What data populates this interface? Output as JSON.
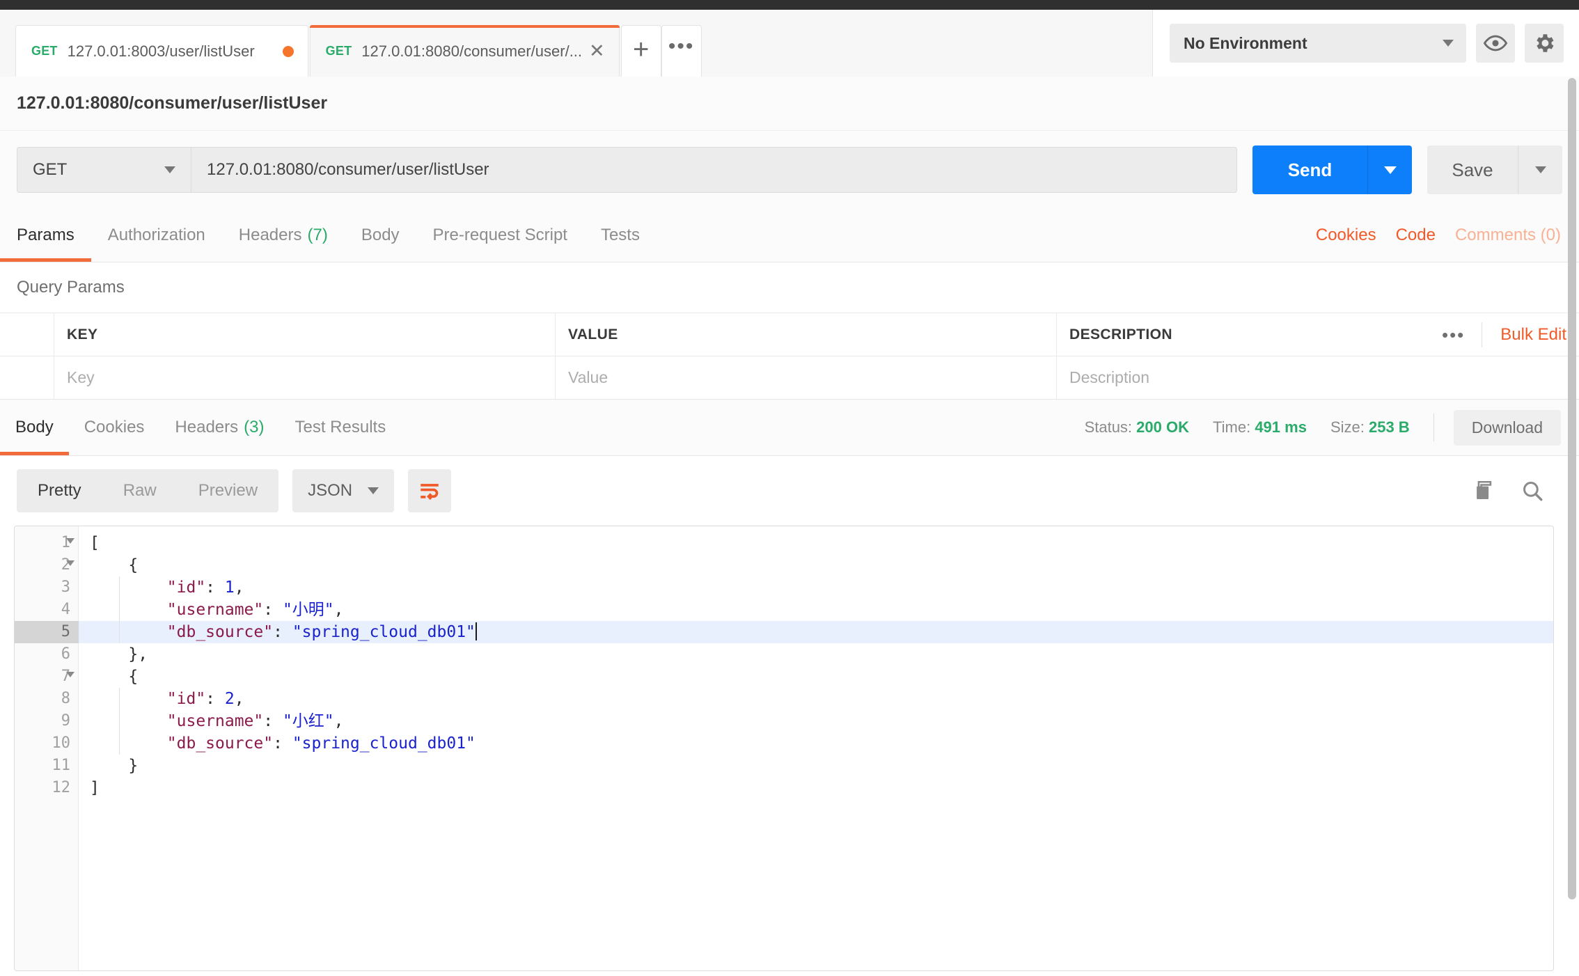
{
  "window": {
    "tabs": [
      {
        "method": "GET",
        "label": "127.0.01:8003/user/listUser",
        "active": false,
        "unsaved": true
      },
      {
        "method": "GET",
        "label": "127.0.01:8080/consumer/user/...",
        "active": true,
        "unsaved": false
      }
    ],
    "new_tab_label": "+",
    "more_tabs_label": "•••"
  },
  "environment": {
    "selected": "No Environment",
    "eye_icon": "eye-icon",
    "settings_icon": "gear-icon"
  },
  "request": {
    "title": "127.0.01:8080/consumer/user/listUser",
    "method": "GET",
    "url": "127.0.01:8080/consumer/user/listUser",
    "send_label": "Send",
    "save_label": "Save",
    "tabs": [
      {
        "label": "Params",
        "count": "",
        "active": true
      },
      {
        "label": "Authorization",
        "count": "",
        "active": false
      },
      {
        "label": "Headers",
        "count": "(7)",
        "active": false
      },
      {
        "label": "Body",
        "count": "",
        "active": false
      },
      {
        "label": "Pre-request Script",
        "count": "",
        "active": false
      },
      {
        "label": "Tests",
        "count": "",
        "active": false
      }
    ],
    "right_links": [
      {
        "label": "Cookies",
        "muted": false
      },
      {
        "label": "Code",
        "muted": false
      },
      {
        "label": "Comments (0)",
        "muted": true
      }
    ]
  },
  "query_params": {
    "section_title": "Query Params",
    "headers": {
      "key": "KEY",
      "value": "VALUE",
      "description": "DESCRIPTION"
    },
    "placeholders": {
      "key": "Key",
      "value": "Value",
      "description": "Description"
    },
    "dots_label": "•••",
    "bulk_edit_label": "Bulk Edit"
  },
  "response": {
    "tabs": [
      {
        "label": "Body",
        "count": "",
        "active": true
      },
      {
        "label": "Cookies",
        "count": "",
        "active": false
      },
      {
        "label": "Headers",
        "count": "(3)",
        "active": false
      },
      {
        "label": "Test Results",
        "count": "",
        "active": false
      }
    ],
    "status_label": "Status:",
    "status_value": "200 OK",
    "time_label": "Time:",
    "time_value": "491 ms",
    "size_label": "Size:",
    "size_value": "253 B",
    "download_label": "Download",
    "view_modes": [
      {
        "label": "Pretty",
        "active": true
      },
      {
        "label": "Raw",
        "active": false
      },
      {
        "label": "Preview",
        "active": false
      }
    ],
    "format": "JSON",
    "wrap_icon": "word-wrap-icon",
    "copy_icon": "copy-icon",
    "search_icon": "search-icon",
    "body_lines": [
      {
        "n": "1",
        "fold": true,
        "indent": 0,
        "tokens": [
          {
            "t": "punct",
            "v": "["
          }
        ]
      },
      {
        "n": "2",
        "fold": true,
        "indent": 0,
        "tokens": [
          {
            "t": "punct",
            "v": "    {"
          }
        ]
      },
      {
        "n": "3",
        "fold": false,
        "indent": 1,
        "tokens": [
          {
            "t": "key",
            "v": "        \"id\""
          },
          {
            "t": "punct",
            "v": ": "
          },
          {
            "t": "num",
            "v": "1"
          },
          {
            "t": "punct",
            "v": ","
          }
        ]
      },
      {
        "n": "4",
        "fold": false,
        "indent": 1,
        "tokens": [
          {
            "t": "key",
            "v": "        \"username\""
          },
          {
            "t": "punct",
            "v": ": "
          },
          {
            "t": "str",
            "v": "\"小明\""
          },
          {
            "t": "punct",
            "v": ","
          }
        ]
      },
      {
        "n": "5",
        "fold": false,
        "indent": 1,
        "active": true,
        "cursor": true,
        "tokens": [
          {
            "t": "key",
            "v": "        \"db_source\""
          },
          {
            "t": "punct",
            "v": ": "
          },
          {
            "t": "str",
            "v": "\"spring_cloud_db01\""
          }
        ]
      },
      {
        "n": "6",
        "fold": false,
        "indent": 0,
        "tokens": [
          {
            "t": "punct",
            "v": "    },"
          }
        ]
      },
      {
        "n": "7",
        "fold": true,
        "indent": 0,
        "tokens": [
          {
            "t": "punct",
            "v": "    {"
          }
        ]
      },
      {
        "n": "8",
        "fold": false,
        "indent": 1,
        "tokens": [
          {
            "t": "key",
            "v": "        \"id\""
          },
          {
            "t": "punct",
            "v": ": "
          },
          {
            "t": "num",
            "v": "2"
          },
          {
            "t": "punct",
            "v": ","
          }
        ]
      },
      {
        "n": "9",
        "fold": false,
        "indent": 1,
        "tokens": [
          {
            "t": "key",
            "v": "        \"username\""
          },
          {
            "t": "punct",
            "v": ": "
          },
          {
            "t": "str",
            "v": "\"小红\""
          },
          {
            "t": "punct",
            "v": ","
          }
        ]
      },
      {
        "n": "10",
        "fold": false,
        "indent": 1,
        "tokens": [
          {
            "t": "key",
            "v": "        \"db_source\""
          },
          {
            "t": "punct",
            "v": ": "
          },
          {
            "t": "str",
            "v": "\"spring_cloud_db01\""
          }
        ]
      },
      {
        "n": "11",
        "fold": false,
        "indent": 0,
        "tokens": [
          {
            "t": "punct",
            "v": "    }"
          }
        ]
      },
      {
        "n": "12",
        "fold": false,
        "indent": 0,
        "tokens": [
          {
            "t": "punct",
            "v": "]"
          }
        ]
      }
    ]
  },
  "colors": {
    "accent_orange": "#f26b3a",
    "send_blue": "#0d7ffb",
    "status_green": "#2aab6a",
    "json_key": "#8b1a4b",
    "json_string": "#1a22cc"
  }
}
